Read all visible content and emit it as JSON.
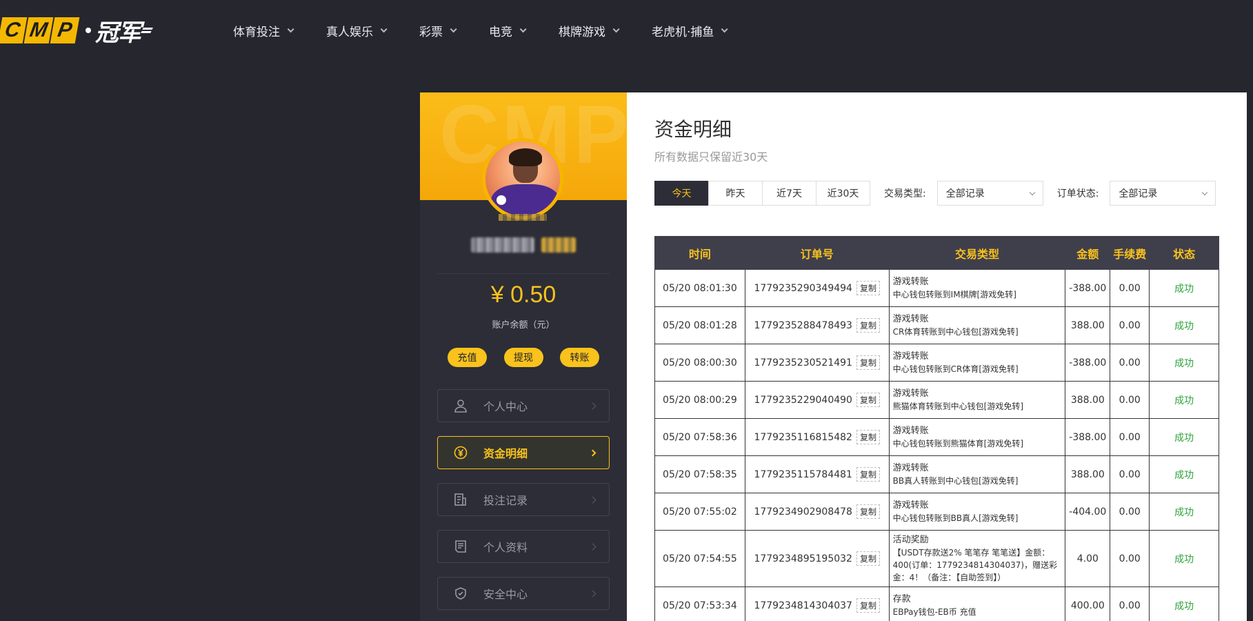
{
  "header": {
    "logo_text": "CMP",
    "logo_cn": "冠军",
    "nav": [
      {
        "label": "体育投注"
      },
      {
        "label": "真人娱乐"
      },
      {
        "label": "彩票"
      },
      {
        "label": "电竞"
      },
      {
        "label": "棋牌游戏"
      },
      {
        "label": "老虎机·捕鱼"
      }
    ]
  },
  "sidebar": {
    "banner_watermark": "CMP",
    "balance": "¥ 0.50",
    "balance_label": "账户余额（元）",
    "actions": [
      {
        "label": "充值"
      },
      {
        "label": "提现"
      },
      {
        "label": "转账"
      }
    ],
    "menu": [
      {
        "label": "个人中心",
        "icon": "user-icon"
      },
      {
        "label": "资金明细",
        "icon": "yuan-circle-icon",
        "active": true
      },
      {
        "label": "投注记录",
        "icon": "bet-record-icon"
      },
      {
        "label": "个人资料",
        "icon": "profile-doc-icon"
      },
      {
        "label": "安全中心",
        "icon": "shield-icon"
      }
    ]
  },
  "main": {
    "title": "资金明细",
    "subtitle": "所有数据只保留近30天",
    "tabs": [
      "今天",
      "昨天",
      "近7天",
      "近30天"
    ],
    "type_label": "交易类型:",
    "type_value": "全部记录",
    "status_label": "订单状态:",
    "status_value": "全部记录",
    "table": {
      "headers": [
        "时间",
        "订单号",
        "交易类型",
        "金额",
        "手续费",
        "状态"
      ],
      "copy_label": "复制",
      "rows": [
        {
          "time": "05/20 08:01:30",
          "order": "1779235290349494",
          "type": "游戏转账",
          "detail": "中心钱包转账到IM棋牌[游戏免转]",
          "amount": "-388.00",
          "fee": "0.00",
          "status": "成功"
        },
        {
          "time": "05/20 08:01:28",
          "order": "1779235288478493",
          "type": "游戏转账",
          "detail": "CR体育转账到中心钱包[游戏免转]",
          "amount": "388.00",
          "fee": "0.00",
          "status": "成功"
        },
        {
          "time": "05/20 08:00:30",
          "order": "1779235230521491",
          "type": "游戏转账",
          "detail": "中心钱包转账到CR体育[游戏免转]",
          "amount": "-388.00",
          "fee": "0.00",
          "status": "成功"
        },
        {
          "time": "05/20 08:00:29",
          "order": "1779235229040490",
          "type": "游戏转账",
          "detail": "熊猫体育转账到中心钱包[游戏免转]",
          "amount": "388.00",
          "fee": "0.00",
          "status": "成功"
        },
        {
          "time": "05/20 07:58:36",
          "order": "1779235116815482",
          "type": "游戏转账",
          "detail": "中心钱包转账到熊猫体育[游戏免转]",
          "amount": "-388.00",
          "fee": "0.00",
          "status": "成功"
        },
        {
          "time": "05/20 07:58:35",
          "order": "1779235115784481",
          "type": "游戏转账",
          "detail": "BB真人转账到中心钱包[游戏免转]",
          "amount": "388.00",
          "fee": "0.00",
          "status": "成功"
        },
        {
          "time": "05/20 07:55:02",
          "order": "1779234902908478",
          "type": "游戏转账",
          "detail": "中心钱包转账到BB真人[游戏免转]",
          "amount": "-404.00",
          "fee": "0.00",
          "status": "成功"
        },
        {
          "time": "05/20 07:54:55",
          "order": "1779234895195032",
          "type": "活动奖励",
          "detail": "【USDT存款送2% 笔笔存 笔笔送】金额：400(订单：1779234814304037)，赠送彩金：4！（备注：【自助签到】）",
          "amount": "4.00",
          "fee": "0.00",
          "status": "成功"
        },
        {
          "time": "05/20 07:53:34",
          "order": "1779234814304037",
          "type": "存款",
          "detail": "EBPay钱包-EB币 充值",
          "amount": "400.00",
          "fee": "0.00",
          "status": "成功"
        }
      ]
    }
  },
  "colors": {
    "accent": "#f9c21c",
    "bg_dark": "#26262f",
    "panel_dark": "#2d2d37",
    "success": "#2fa43b"
  }
}
